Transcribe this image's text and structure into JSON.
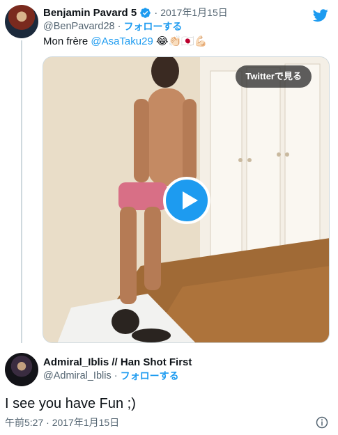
{
  "tweet": {
    "display_name": "Benjamin Pavard 5",
    "timestamp": "2017年1月15日",
    "handle": "@BenPavard28",
    "follow_label": "フォローする",
    "text_prefix": "Mon frère ",
    "mention": "@AsaTaku29",
    "emojis": "😂👏🏻🇯🇵💪🏻",
    "verified": true
  },
  "media": {
    "watch_on_twitter": "Twitterで見る",
    "play_icon": "play-icon"
  },
  "reply": {
    "display_name": "Admiral_Iblis // Han Shot First",
    "handle": "@Admiral_Iblis",
    "follow_label": "フォローする",
    "text": "I see you have Fun ;)",
    "timestamp": "午前5:27 · 2017年1月15日"
  },
  "colors": {
    "accent": "#1d9bf0",
    "secondary_text": "#536471",
    "primary_text": "#0f1419"
  }
}
